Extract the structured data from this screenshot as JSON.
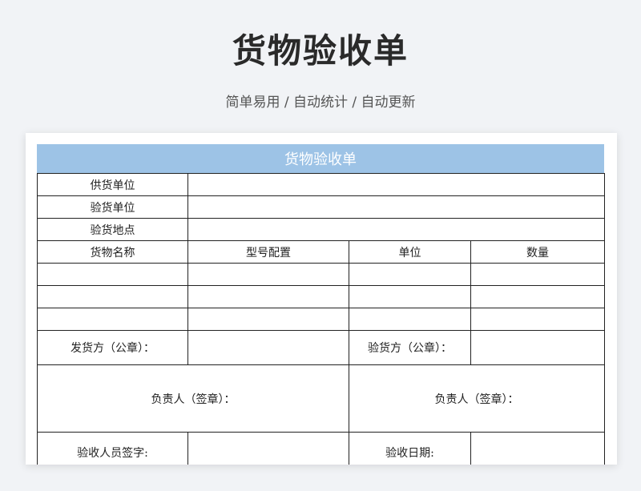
{
  "page": {
    "title": "货物验收单",
    "subtitle": "简单易用 / 自动统计 / 自动更新"
  },
  "form": {
    "header": "货物验收单",
    "supplier_label": "供货单位",
    "inspector_unit_label": "验货单位",
    "inspection_location_label": "验货地点",
    "columns": [
      "货物名称",
      "型号配置",
      "单位",
      "数量"
    ],
    "empty_rows": 3,
    "shipper_seal_label": "发货方（公章）：",
    "receiver_seal_label": "验货方（公章）：",
    "shipper_person_label": "负责人（签章）：",
    "receiver_person_label": "负责人（签章）：",
    "inspector_signature_label": "验收人员签字:",
    "inspection_date_label": "验收日期:"
  },
  "colors": {
    "header_bg": "#9dc3e6",
    "page_bg": "#f1f3f6"
  }
}
